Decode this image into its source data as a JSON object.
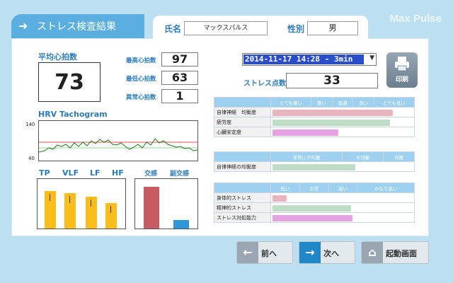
{
  "header": {
    "title": "ストレス検査結果",
    "brand": "Max Pulse"
  },
  "patient": {
    "name_label": "氏名",
    "name_value": "マックスパルス",
    "sex_label": "性別",
    "sex_value": "男"
  },
  "heart_rate": {
    "avg_label": "平均心拍数",
    "avg_value": "73",
    "max_label": "最高心拍数",
    "max_value": "97",
    "min_label": "最低心拍数",
    "min_value": "63",
    "abnormal_label": "異常心拍数",
    "abnormal_value": "1"
  },
  "hrv": {
    "title": "HRV Tachogram",
    "y_top": "140",
    "y_bottom": "40"
  },
  "spectrum": {
    "labels": [
      "TP",
      "VLF",
      "LF",
      "HF"
    ],
    "values": [
      0.8,
      0.75,
      0.68,
      0.55
    ]
  },
  "ans": {
    "symp_label": "交感",
    "para_label": "副交感",
    "symp": 0.95,
    "para": 0.2
  },
  "session": {
    "selected": "2014-11-17 14:28 - 3min"
  },
  "stress_score": {
    "label": "ストレス点数",
    "value": "33"
  },
  "print": {
    "label": "印刷"
  },
  "table1": {
    "headers": [
      "とても悪い",
      "悪い",
      "普通",
      "良い",
      "とても良い"
    ],
    "rows": [
      {
        "label": "自律神経　均衡度",
        "value": 0.86,
        "color": "#e9b3bf"
      },
      {
        "label": "疲労度",
        "value": 0.84,
        "color": "#bfdcc6"
      },
      {
        "label": "心臓安定度",
        "value": 0.48,
        "color": "#e6a3e3"
      }
    ]
  },
  "table2": {
    "headers": [
      "非常に不均衡",
      "不均衡",
      "均衡"
    ],
    "rows": [
      {
        "label": "自律神経の均衡度",
        "value": 0.6,
        "color": "#bfdcc6"
      }
    ]
  },
  "table3": {
    "headers": [
      "低い",
      "正常",
      "高い",
      "かなり高い"
    ],
    "rows": [
      {
        "label": "身体的ストレス",
        "value": 0.12,
        "color": "#e9b3bf"
      },
      {
        "label": "精神的ストレス",
        "value": 0.57,
        "color": "#bfdcc6"
      },
      {
        "label": "ストレス対処能力",
        "value": 0.58,
        "color": "#e6a3e3"
      }
    ]
  },
  "nav": {
    "prev": "前へ",
    "next": "次へ",
    "home": "起動画面"
  }
}
